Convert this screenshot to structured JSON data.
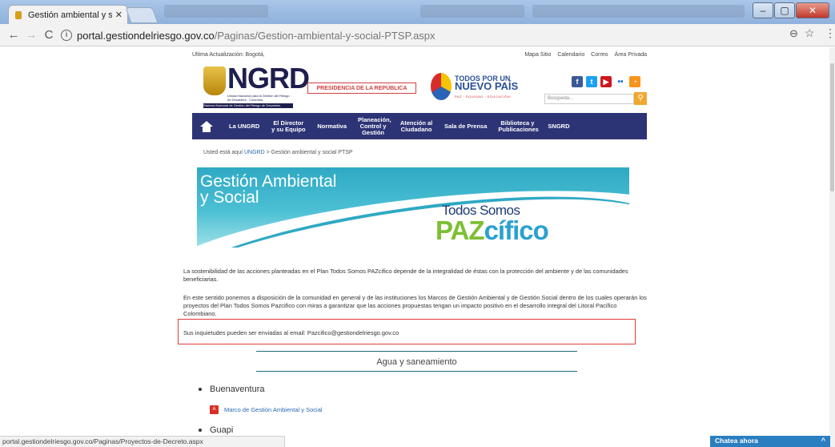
{
  "browser": {
    "tab_title": "Gestión ambiental y soci",
    "tab_close": "✕",
    "url_domain": "portal.gestiondelriesgo.gov.co",
    "url_path": "/Paginas/Gestion-ambiental-y-social-PTSP.aspx",
    "status_url": "portal.gestiondelriesgo.gov.co/Paginas/Proyectos-de-Decreto.aspx"
  },
  "site": {
    "update_label": "Ultima Actualización: Bogotá,",
    "top_links": [
      "Mapa Sitio",
      "Calendario",
      "Correo",
      "Área Privada"
    ],
    "logo_text": "NGRD",
    "logo_sub": "Unidad Nacional para la Gestión del Riesgo de Desastres · Colombia",
    "logo_bar": "Sistema Nacional de Gestión del Riesgo de Desastres",
    "presidencia": "PRESIDENCIA DE LA REPÚBLICA",
    "todos_line1": "TODOS POR UN",
    "todos_line2": "NUEVO PAÍS",
    "todos_foot": "PAZ · EQUIDAD · EDUCACIÓN",
    "search_placeholder": "Búsqueda...",
    "nav": [
      "La UNGRD",
      "El Director y su Equipo",
      "Normativa",
      "Planeación, Control y Gestión",
      "Atención al Ciudadano",
      "Sala de Prensa",
      "Biblioteca y Publicaciones",
      "SNGRD"
    ]
  },
  "breadcrumb": {
    "prefix": "Usted está aquí",
    "link": "UNGRD",
    "sep": ">",
    "current": "Gestión ambiental y social PTSP"
  },
  "banner": {
    "title_line1": "Gestión Ambiental",
    "title_line2": "y Social",
    "slogan": "Todos Somos",
    "paz": "PAZ",
    "cifico": "cífico"
  },
  "content": {
    "p1": "La sostenibilidad de las acciones planteadas en el Plan Todos Somos PAZcifico depende de la integralidad de éstas con la protección del ambiente y de las comunidades beneficiarias.",
    "p2": "En este sentido ponemos a disposición de la comunidad en general y de las instituciones los Marcos de Gestión Ambiental y de Gestión Social dentro de los cuales operarán los proyectos del Plan Todos Somos Pazcifico con miras a garantizar que las acciones propuestas tengan un impacto positivo en el desarrollo integral del Litoral Pacífico Colombiano.",
    "p3": "Sus inquietudes pueden ser enviadas al email: Pazcifico@gestiondelriesgo.gov.co",
    "section_title": "Agua y saneamiento",
    "item1": "Buenaventura",
    "pdf_link": "Marco de Gestión Ambiental y Social",
    "item2": "Guapi"
  },
  "chat": {
    "label": "Chatea ahora",
    "caret": "^"
  }
}
